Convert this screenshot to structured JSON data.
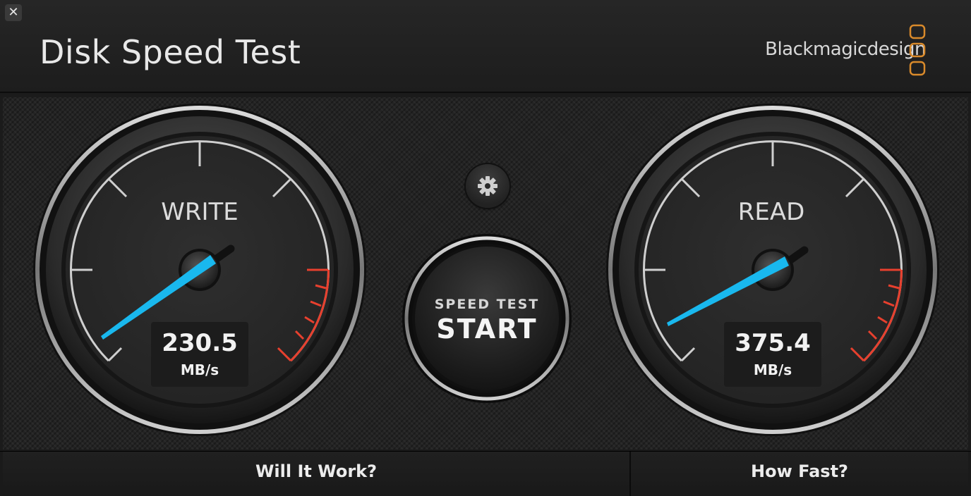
{
  "window": {
    "close_glyph": "✕"
  },
  "header": {
    "title": "Disk Speed Test",
    "brand": "Blackmagicdesign"
  },
  "gauges": {
    "write": {
      "label": "WRITE",
      "value": "230.5",
      "unit": "MB/s"
    },
    "read": {
      "label": "READ",
      "value": "375.4",
      "unit": "MB/s"
    }
  },
  "controls": {
    "settings_icon": "gear-icon",
    "start_small": "SPEED TEST",
    "start_big": "START"
  },
  "footer": {
    "tab_will": "Will It Work?",
    "tab_fast": "How Fast?"
  },
  "colors": {
    "needle": "#19b8ee",
    "redzone": "#e8402e",
    "brand_orange": "#d98a2b"
  }
}
